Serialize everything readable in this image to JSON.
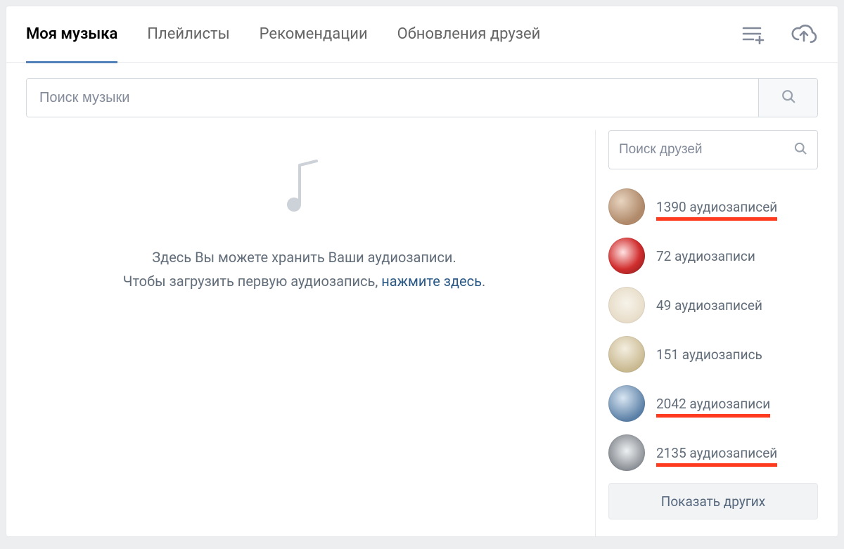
{
  "tabs": {
    "my_music": "Моя музыка",
    "playlists": "Плейлисты",
    "recommendations": "Рекомендации",
    "friends_updates": "Обновления друзей"
  },
  "icons": {
    "playlist_add": "playlist-add-icon",
    "upload_cloud": "upload-cloud-icon",
    "search": "search-icon",
    "music_note": "music-note-icon"
  },
  "search": {
    "placeholder": "Поиск музыки"
  },
  "empty": {
    "line1": "Здесь Вы можете хранить Ваши аудиозаписи.",
    "line2_prefix": "Чтобы загрузить первую аудиозапись, ",
    "line2_link": "нажмите здесь",
    "line2_suffix": "."
  },
  "sidebar": {
    "search_placeholder": "Поиск друзей",
    "friends": [
      {
        "count_label": "1390 аудиозаписей",
        "highlighted": true,
        "avatar_class": "g1"
      },
      {
        "count_label": "72 аудиозаписи",
        "highlighted": false,
        "avatar_class": "g2"
      },
      {
        "count_label": "49 аудиозаписей",
        "highlighted": false,
        "avatar_class": "g3"
      },
      {
        "count_label": "151 аудиозапись",
        "highlighted": false,
        "avatar_class": "g4"
      },
      {
        "count_label": "2042 аудиозаписи",
        "highlighted": true,
        "avatar_class": "g5"
      },
      {
        "count_label": "2135 аудиозаписей",
        "highlighted": true,
        "avatar_class": "g6"
      }
    ],
    "show_more": "Показать других"
  }
}
